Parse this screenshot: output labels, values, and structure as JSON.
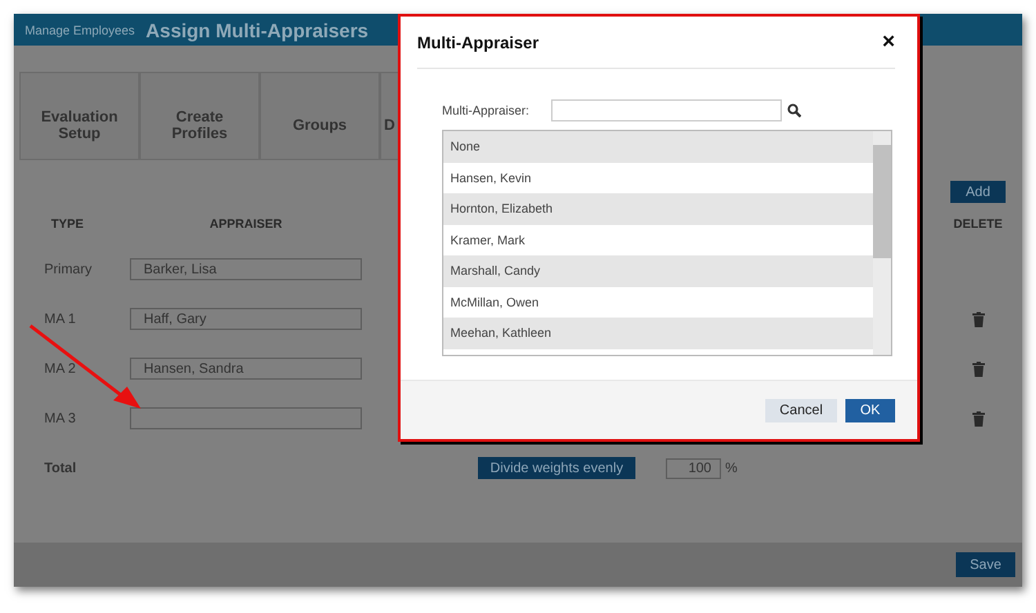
{
  "header": {
    "breadcrumb": "Manage Employees",
    "title": "Assign Multi-Appraisers"
  },
  "tabs": [
    {
      "label": "Evaluation Setup"
    },
    {
      "label": "Create Profiles"
    },
    {
      "label": "Groups"
    },
    {
      "label": "D"
    }
  ],
  "add_button": "Add",
  "table": {
    "columns": [
      "TYPE",
      "APPRAISER",
      "DELETE"
    ],
    "rows": [
      {
        "type": "Primary",
        "appraiser": "Barker, Lisa",
        "deletable": false
      },
      {
        "type": "MA 1",
        "appraiser": "Haff, Gary",
        "deletable": true
      },
      {
        "type": "MA 2",
        "appraiser": "Hansen, Sandra",
        "deletable": true
      },
      {
        "type": "MA 3",
        "appraiser": "",
        "deletable": true
      }
    ],
    "total": {
      "label": "Total",
      "button": "Divide weights evenly",
      "value": "100",
      "unit": "%"
    }
  },
  "save_button": "Save",
  "dialog": {
    "title": "Multi-Appraiser",
    "close": "×",
    "search_label": "Multi-Appraiser:",
    "options": [
      {
        "label": "None"
      },
      {
        "label": "Hansen, Kevin"
      },
      {
        "label": "Hornton, Elizabeth"
      },
      {
        "label": "Kramer, Mark"
      },
      {
        "label": "Marshall, Candy"
      },
      {
        "label": "McMillan, Owen"
      },
      {
        "label": "Meehan, Kathleen"
      }
    ],
    "buttons": [
      {
        "label": "Cancel",
        "kind": "secondary"
      },
      {
        "label": "OK",
        "kind": "primary"
      }
    ]
  }
}
